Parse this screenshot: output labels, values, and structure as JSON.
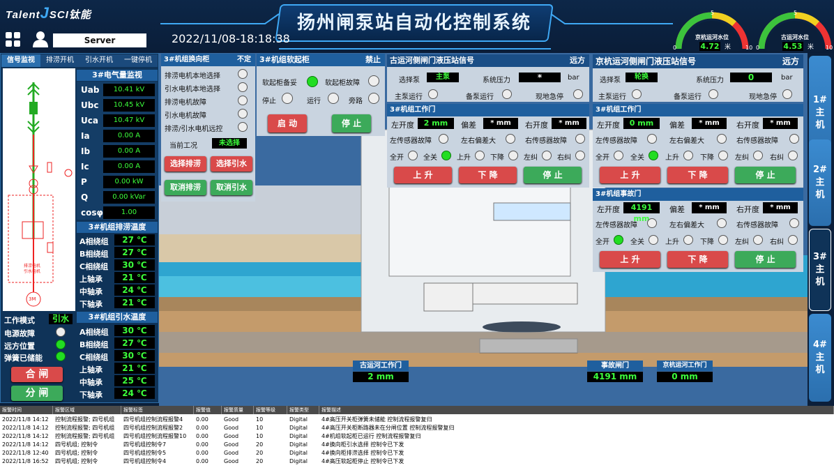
{
  "brand": {
    "logo_text": "Talent",
    "logo_j": "J",
    "logo_rest": "SCI钛能"
  },
  "title": "扬州闸泵站自动化控制系统",
  "datetime": "2022/11/08-18:18:38",
  "user": "Server",
  "gauges": [
    {
      "name": "京杭运河水位",
      "value": "4.72",
      "unit": "米",
      "min": "0",
      "mid": "5",
      "max": "10",
      "level": 0.472
    },
    {
      "name": "古运河水位",
      "value": "4.53",
      "unit": "米",
      "min": "0",
      "mid": "5",
      "max": "10",
      "level": 0.453
    }
  ],
  "left_tabs": [
    "信号监视",
    "排涝开机",
    "引水开机",
    "一键停机"
  ],
  "elec": {
    "title": "3#电气量监视",
    "rows": [
      {
        "k": "Uab",
        "v": "10.41 kV"
      },
      {
        "k": "Ubc",
        "v": "10.45 kV"
      },
      {
        "k": "Uca",
        "v": "10.47 kV"
      },
      {
        "k": "Ia",
        "v": "0.00 A"
      },
      {
        "k": "Ib",
        "v": "0.00 A"
      },
      {
        "k": "Ic",
        "v": "0.00 A"
      },
      {
        "k": "P",
        "v": "0.00 kW"
      },
      {
        "k": "Q",
        "v": "0.00 kVar"
      },
      {
        "k": "cosφ",
        "v": "1.00"
      }
    ]
  },
  "drain_temp": {
    "title": "3#机组排涝温度",
    "rows": [
      {
        "k": "A相绕组",
        "v": "27 ℃"
      },
      {
        "k": "B相绕组",
        "v": "27 ℃"
      },
      {
        "k": "C相绕组",
        "v": "30 ℃"
      },
      {
        "k": "上轴承",
        "v": "21 ℃"
      },
      {
        "k": "中轴承",
        "v": "24 ℃"
      },
      {
        "k": "下轴承",
        "v": "21 ℃"
      }
    ]
  },
  "intake_temp": {
    "title": "3#机组引水温度",
    "rows": [
      {
        "k": "A相绕组",
        "v": "30 ℃"
      },
      {
        "k": "B相绕组",
        "v": "27 ℃"
      },
      {
        "k": "C相绕组",
        "v": "30 ℃"
      },
      {
        "k": "上轴承",
        "v": "21 ℃"
      },
      {
        "k": "中轴承",
        "v": "25 ℃"
      },
      {
        "k": "下轴承",
        "v": "24 ℃"
      }
    ]
  },
  "status": {
    "mode_label": "工作模式",
    "mode": "引水",
    "power_fault": "电源故障",
    "remote": "远方位置",
    "spring": "弹簧已储能",
    "close": "合 闸",
    "open": "分 闸"
  },
  "diagram": {
    "label1": "排涝电机",
    "label2": "引水电机",
    "motor": "3M"
  },
  "reverse": {
    "title": "3#机组换向柜",
    "state": "不定",
    "items": [
      "排涝电机本地选择",
      "引水电机本地选择",
      "排涝电机故障",
      "引水电机故障",
      "排涝/引水电机远控"
    ],
    "cond_label": "当前工况",
    "cond": "未选择",
    "b1": "选择排涝",
    "b2": "选择引水",
    "b3": "取消排涝",
    "b4": "取消引水"
  },
  "soft": {
    "title": "3#机组软起柜",
    "state": "禁止",
    "ready": "软起柜备妥",
    "fault": "软起柜故障",
    "stop": "停止",
    "run": "运行",
    "bypass": "旁路",
    "start": "启 动",
    "stopbtn": "停 止"
  },
  "gu": {
    "title": "古运河侧闸门液压站信号",
    "state": "远方",
    "pump_label": "选择泵",
    "pump": "主泵",
    "pressure_label": "系统压力",
    "pressure": "*",
    "unit": "bar",
    "main": "主泵运行",
    "spare": "备泵运行",
    "estop": "现地急停",
    "gate_title": "3#机组工作门",
    "left": "左开度",
    "left_v": "2 mm",
    "dev": "偏差",
    "dev_v": "* mm",
    "right": "右开度",
    "right_v": "* mm",
    "lsf": "左传感器故障",
    "lrd": "左右偏差大",
    "rsf": "右传感器故障",
    "open_all": "全开",
    "close_all": "全关",
    "up": "上升",
    "down": "下降",
    "lcorr": "左纠",
    "rcorr": "右纠",
    "b_up": "上 升",
    "b_down": "下 降",
    "b_stop": "停 止"
  },
  "jh": {
    "title": "京杭运河侧闸门液压站信号",
    "state": "远方",
    "pump_label": "选择泵",
    "pump": "轮换",
    "pressure_label": "系统压力",
    "pressure": "0",
    "unit": "bar",
    "main": "主泵运行",
    "spare": "备泵运行",
    "estop": "现地急停",
    "gate_title": "3#机组工作门",
    "left": "左开度",
    "left_v": "0 mm",
    "dev": "偏差",
    "dev_v": "* mm",
    "right": "右开度",
    "right_v": "* mm",
    "lsf": "左传感器故障",
    "lrd": "左右偏差大",
    "rsf": "右传感器故障",
    "open_all": "全开",
    "close_all": "全关",
    "up": "上升",
    "down": "下降",
    "lcorr": "左纠",
    "rcorr": "右纠",
    "b_up": "上 升",
    "b_down": "下 降",
    "b_stop": "停 止",
    "acc_title": "3#机组事故门",
    "acc_left_v": "4191 mm",
    "acc_dev_v": "* mm",
    "acc_right_v": "* mm"
  },
  "scene": {
    "g1": "古运河工作门",
    "g1v": "2 mm",
    "g2": "事故闸门",
    "g2v": "4191 mm",
    "g3": "京杭运河工作门",
    "g3v": "0 mm"
  },
  "right_tabs": [
    "1#\n主\n机",
    "2#\n主\n机",
    "3#\n主\n机",
    "4#\n主\n机"
  ],
  "alarm": {
    "headers": [
      "报警时间",
      "报警区域",
      "报警标签",
      "报警值",
      "报警质量",
      "报警等级",
      "报警类型",
      "报警描述"
    ],
    "rows": [
      [
        "2022/11/8 14:12",
        "控制流程报警; 四号机组",
        "四号机组控制流程报警4",
        "0.00",
        "Good",
        "10",
        "Digital",
        "4#高压开关柜弹簧未储能 控制流程报警复归"
      ],
      [
        "2022/11/8 14:12",
        "控制流程报警; 四号机组",
        "四号机组控制流程报警2",
        "0.00",
        "Good",
        "10",
        "Digital",
        "4#高压开关柜断路器未在分闸位置 控制流程报警复归"
      ],
      [
        "2022/11/8 14:12",
        "控制流程报警; 四号机组",
        "四号机组控制流程报警10",
        "0.00",
        "Good",
        "10",
        "Digital",
        "4#机组软起柜已运行 控制流程报警复归"
      ],
      [
        "2022/11/8 14:12",
        "四号机组; 控制令",
        "四号机组控制令7",
        "0.00",
        "Good",
        "20",
        "Digital",
        "4#换向柜引水选择 控制令已下发"
      ],
      [
        "2022/11/8 12:40",
        "四号机组; 控制令",
        "四号机组控制令5",
        "0.00",
        "Good",
        "20",
        "Digital",
        "4#换向柜排涝选择 控制令已下发"
      ],
      [
        "2022/11/8 16:52",
        "四号机组; 控制令",
        "四号机组控制令4",
        "0.00",
        "Good",
        "20",
        "Digital",
        "4#高压软起柜停止 控制令已下发"
      ]
    ]
  }
}
